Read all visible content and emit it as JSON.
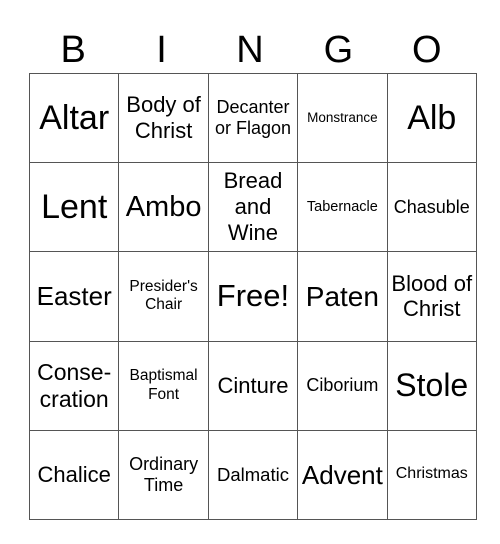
{
  "header": [
    "B",
    "I",
    "N",
    "G",
    "O"
  ],
  "rows": [
    [
      "Altar",
      "Body of Christ",
      "Decanter or Flagon",
      "Monstrance",
      "Alb"
    ],
    [
      "Lent",
      "Ambo",
      "Bread and Wine",
      "Tabernacle",
      "Chasuble"
    ],
    [
      "Easter",
      "Presider's Chair",
      "Free!",
      "Paten",
      "Blood of Christ"
    ],
    [
      "Conse-cration",
      "Baptismal Font",
      "Cinture",
      "Ciborium",
      "Stole"
    ],
    [
      "Chalice",
      "Ordinary Time",
      "Dalmatic",
      "Advent",
      "Christmas"
    ]
  ]
}
